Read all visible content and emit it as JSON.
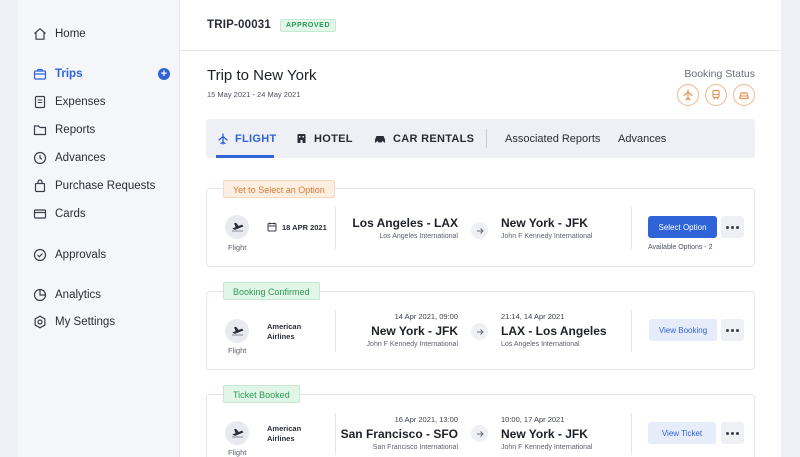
{
  "sidebar": {
    "items": [
      {
        "label": "Home",
        "icon": "home-icon"
      },
      {
        "label": "Trips",
        "icon": "suitcase-icon",
        "active": true
      },
      {
        "label": "Expenses",
        "icon": "receipt-icon"
      },
      {
        "label": "Reports",
        "icon": "folder-icon"
      },
      {
        "label": "Advances",
        "icon": "clock-icon"
      },
      {
        "label": "Purchase Requests",
        "icon": "bag-icon"
      },
      {
        "label": "Cards",
        "icon": "card-icon"
      },
      {
        "label": "Approvals",
        "icon": "check-circle-icon"
      },
      {
        "label": "Analytics",
        "icon": "pie-chart-icon"
      },
      {
        "label": "My Settings",
        "icon": "gear-icon"
      }
    ],
    "trips_add": "+"
  },
  "header": {
    "trip_id": "TRIP-00031",
    "status": "APPROVED"
  },
  "trip": {
    "title": "Trip to New York",
    "dates": "15 May 2021 - 24 May 2021",
    "booking_status_label": "Booking Status",
    "booking_status_icons": [
      "plane-icon",
      "train-icon",
      "car-icon"
    ]
  },
  "tabs": {
    "flight": "FLIGHT",
    "hotel": "HOTEL",
    "car_rentals": "CAR RENTALS",
    "associated_reports": "Associated Reports",
    "advances": "Advances"
  },
  "bookings": [
    {
      "status": "Yet to Select an Option",
      "type_label": "Flight",
      "date": "18 APR 2021",
      "from_city": "Los Angeles - LAX",
      "from_airport": "Los Angeles International",
      "to_city": "New York - JFK",
      "to_airport": "John F Kennedy International",
      "action": "Select Option",
      "note": "Available Options - 2"
    },
    {
      "status": "Booking Confirmed",
      "type_label": "Flight",
      "airline_line1": "American",
      "airline_line2": "Airlines",
      "dep_time": "14 Apr 2021, 09:00",
      "from_city": "New York - JFK",
      "from_airport": "John F Kennedy International",
      "arr_time": "21:14, 14 Apr 2021",
      "to_city": "LAX - Los Angeles",
      "to_airport": "Los Angeles International",
      "action": "View Booking"
    },
    {
      "status": "Ticket Booked",
      "type_label": "Flight",
      "airline_line1": "American",
      "airline_line2": "Airlines",
      "dep_time": "16 Apr 2021, 13:00",
      "from_city": "San Francisco - SFO",
      "from_airport": "San Francisco International",
      "arr_time": "10:00, 17 Apr 2021",
      "to_city": "New York - JFK",
      "to_airport": "John F Kennedy International",
      "action": "View Ticket"
    }
  ],
  "colors": {
    "accent": "#2f64d8",
    "orange": "#d97a2e",
    "green": "#2a9a55"
  }
}
